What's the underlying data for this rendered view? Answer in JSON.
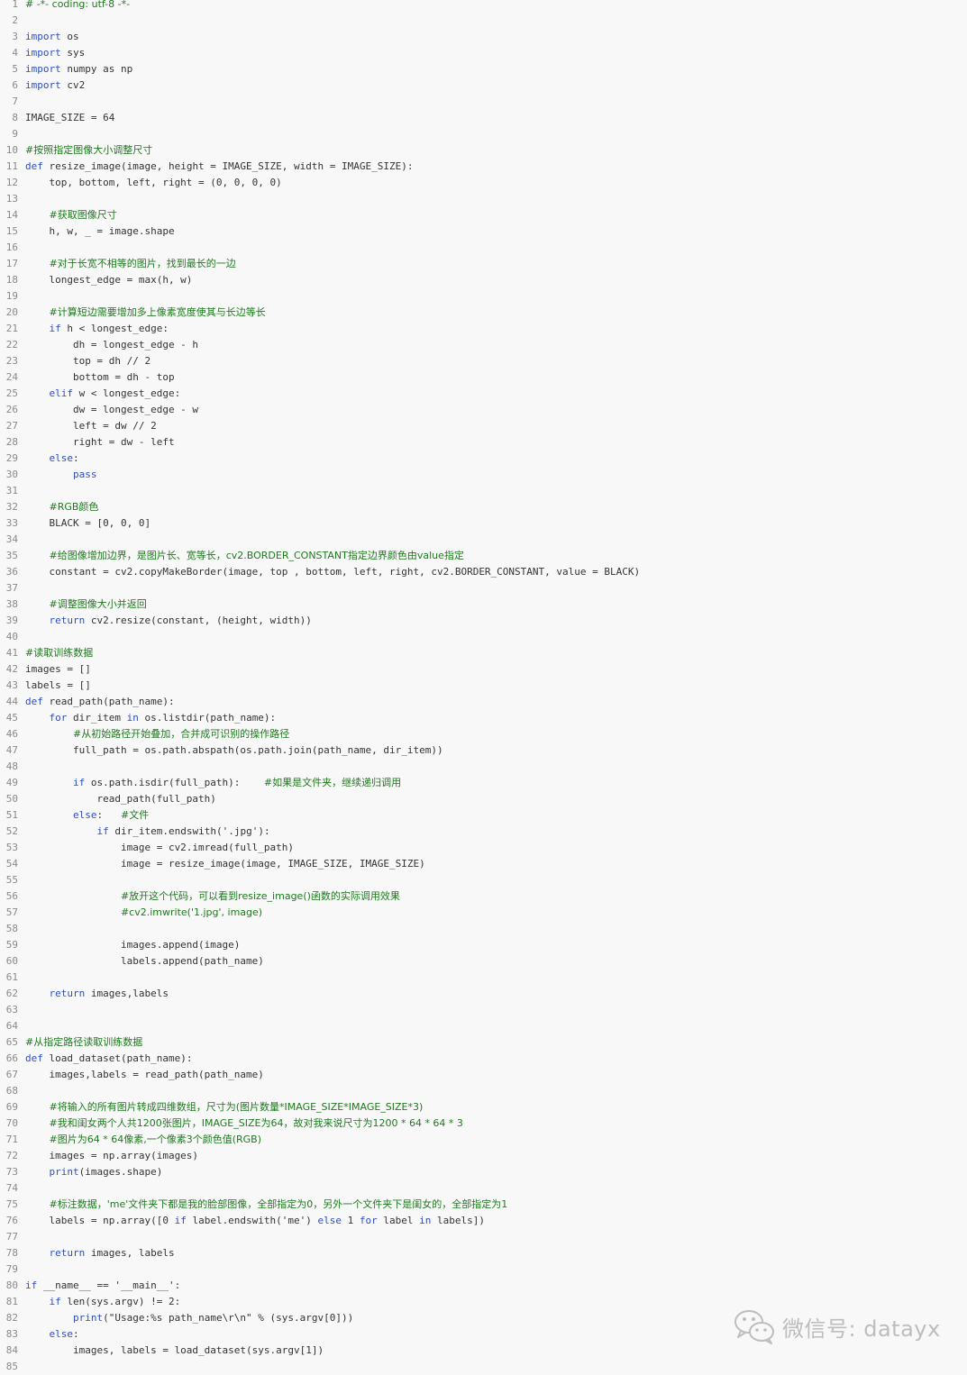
{
  "code_lines": [
    [
      [
        "cm",
        "# -*- coding: utf-8 -*-"
      ]
    ],
    [],
    [
      [
        "kw",
        "import"
      ],
      [
        "t",
        " os"
      ]
    ],
    [
      [
        "kw",
        "import"
      ],
      [
        "t",
        " sys"
      ]
    ],
    [
      [
        "kw",
        "import"
      ],
      [
        "t",
        " numpy as np"
      ]
    ],
    [
      [
        "kw",
        "import"
      ],
      [
        "t",
        " cv2"
      ]
    ],
    [],
    [
      [
        "t",
        "IMAGE_SIZE = 64"
      ]
    ],
    [],
    [
      [
        "cm",
        "#按照指定图像大小调整尺寸"
      ]
    ],
    [
      [
        "kw",
        "def"
      ],
      [
        "t",
        " resize_image(image, height = IMAGE_SIZE, width = IMAGE_SIZE):"
      ]
    ],
    [
      [
        "t",
        "    top, bottom, left, right = (0, 0, 0, 0)"
      ]
    ],
    [],
    [
      [
        "t",
        "    "
      ],
      [
        "cm",
        "#获取图像尺寸"
      ]
    ],
    [
      [
        "t",
        "    h, w, _ = image.shape"
      ]
    ],
    [],
    [
      [
        "t",
        "    "
      ],
      [
        "cm",
        "#对于长宽不相等的图片，找到最长的一边"
      ]
    ],
    [
      [
        "t",
        "    longest_edge = max(h, w)"
      ]
    ],
    [],
    [
      [
        "t",
        "    "
      ],
      [
        "cm",
        "#计算短边需要增加多上像素宽度使其与长边等长"
      ]
    ],
    [
      [
        "t",
        "    "
      ],
      [
        "kw",
        "if"
      ],
      [
        "t",
        " h < longest_edge:"
      ]
    ],
    [
      [
        "t",
        "        dh = longest_edge - h"
      ]
    ],
    [
      [
        "t",
        "        top = dh // 2"
      ]
    ],
    [
      [
        "t",
        "        bottom = dh - top"
      ]
    ],
    [
      [
        "t",
        "    "
      ],
      [
        "kw",
        "elif"
      ],
      [
        "t",
        " w < longest_edge:"
      ]
    ],
    [
      [
        "t",
        "        dw = longest_edge - w"
      ]
    ],
    [
      [
        "t",
        "        left = dw // 2"
      ]
    ],
    [
      [
        "t",
        "        right = dw - left"
      ]
    ],
    [
      [
        "t",
        "    "
      ],
      [
        "kw",
        "else"
      ],
      [
        "t",
        ":"
      ]
    ],
    [
      [
        "t",
        "        "
      ],
      [
        "kw",
        "pass"
      ]
    ],
    [],
    [
      [
        "t",
        "    "
      ],
      [
        "cm",
        "#RGB颜色"
      ]
    ],
    [
      [
        "t",
        "    BLACK = [0, 0, 0]"
      ]
    ],
    [],
    [
      [
        "t",
        "    "
      ],
      [
        "cm",
        "#给图像增加边界，是图片长、宽等长，cv2.BORDER_CONSTANT指定边界颜色由value指定"
      ]
    ],
    [
      [
        "t",
        "    constant = cv2.copyMakeBorder(image, top , bottom, left, right, cv2.BORDER_CONSTANT, value = BLACK)"
      ]
    ],
    [],
    [
      [
        "t",
        "    "
      ],
      [
        "cm",
        "#调整图像大小并返回"
      ]
    ],
    [
      [
        "t",
        "    "
      ],
      [
        "kw",
        "return"
      ],
      [
        "t",
        " cv2.resize(constant, (height, width))"
      ]
    ],
    [],
    [
      [
        "cm",
        "#读取训练数据"
      ]
    ],
    [
      [
        "t",
        "images = []"
      ]
    ],
    [
      [
        "t",
        "labels = []"
      ]
    ],
    [
      [
        "kw",
        "def"
      ],
      [
        "t",
        " read_path(path_name):"
      ]
    ],
    [
      [
        "t",
        "    "
      ],
      [
        "kw",
        "for"
      ],
      [
        "t",
        " dir_item "
      ],
      [
        "kw",
        "in"
      ],
      [
        "t",
        " os.listdir(path_name):"
      ]
    ],
    [
      [
        "t",
        "        "
      ],
      [
        "cm",
        "#从初始路径开始叠加，合并成可识别的操作路径"
      ]
    ],
    [
      [
        "t",
        "        full_path = os.path.abspath(os.path.join(path_name, dir_item))"
      ]
    ],
    [],
    [
      [
        "t",
        "        "
      ],
      [
        "kw",
        "if"
      ],
      [
        "t",
        " os.path.isdir(full_path):    "
      ],
      [
        "cm",
        "#如果是文件夹，继续递归调用"
      ]
    ],
    [
      [
        "t",
        "            read_path(full_path)"
      ]
    ],
    [
      [
        "t",
        "        "
      ],
      [
        "kw",
        "else"
      ],
      [
        "t",
        ":   "
      ],
      [
        "cm",
        "#文件"
      ]
    ],
    [
      [
        "t",
        "            "
      ],
      [
        "kw",
        "if"
      ],
      [
        "t",
        " dir_item.endswith("
      ],
      [
        "str",
        "'.jpg'"
      ],
      [
        "t",
        "):"
      ]
    ],
    [
      [
        "t",
        "                image = cv2.imread(full_path)"
      ]
    ],
    [
      [
        "t",
        "                image = resize_image(image, IMAGE_SIZE, IMAGE_SIZE)"
      ]
    ],
    [],
    [
      [
        "t",
        "                "
      ],
      [
        "cm",
        "#放开这个代码，可以看到resize_image()函数的实际调用效果"
      ]
    ],
    [
      [
        "t",
        "                "
      ],
      [
        "cm",
        "#cv2.imwrite('1.jpg', image)"
      ]
    ],
    [],
    [
      [
        "t",
        "                images.append(image)"
      ]
    ],
    [
      [
        "t",
        "                labels.append(path_name)"
      ]
    ],
    [],
    [
      [
        "t",
        "    "
      ],
      [
        "kw",
        "return"
      ],
      [
        "t",
        " images,labels"
      ]
    ],
    [],
    [],
    [
      [
        "cm",
        "#从指定路径读取训练数据"
      ]
    ],
    [
      [
        "kw",
        "def"
      ],
      [
        "t",
        " load_dataset(path_name):"
      ]
    ],
    [
      [
        "t",
        "    images,labels = read_path(path_name)"
      ]
    ],
    [],
    [
      [
        "t",
        "    "
      ],
      [
        "cm",
        "#将输入的所有图片转成四维数组，尺寸为(图片数量*IMAGE_SIZE*IMAGE_SIZE*3)"
      ]
    ],
    [
      [
        "t",
        "    "
      ],
      [
        "cm",
        "#我和闺女两个人共1200张图片，IMAGE_SIZE为64，故对我来说尺寸为1200 * 64 * 64 * 3"
      ]
    ],
    [
      [
        "t",
        "    "
      ],
      [
        "cm",
        "#图片为64 * 64像素,一个像素3个颜色值(RGB)"
      ]
    ],
    [
      [
        "t",
        "    images = np.array(images)"
      ]
    ],
    [
      [
        "t",
        "    "
      ],
      [
        "kw",
        "print"
      ],
      [
        "t",
        "(images.shape)"
      ]
    ],
    [],
    [
      [
        "t",
        "    "
      ],
      [
        "cm",
        "#标注数据，'me'文件夹下都是我的脸部图像，全部指定为0，另外一个文件夹下是闺女的，全部指定为1"
      ]
    ],
    [
      [
        "t",
        "    labels = np.array([0 "
      ],
      [
        "kw",
        "if"
      ],
      [
        "t",
        " label.endswith("
      ],
      [
        "str",
        "'me'"
      ],
      [
        "t",
        ") "
      ],
      [
        "kw",
        "else"
      ],
      [
        "t",
        " 1 "
      ],
      [
        "kw",
        "for"
      ],
      [
        "t",
        " label "
      ],
      [
        "kw",
        "in"
      ],
      [
        "t",
        " labels])"
      ]
    ],
    [],
    [
      [
        "t",
        "    "
      ],
      [
        "kw",
        "return"
      ],
      [
        "t",
        " images, labels"
      ]
    ],
    [],
    [
      [
        "kw",
        "if"
      ],
      [
        "t",
        " __name__ == "
      ],
      [
        "str",
        "'__main__'"
      ],
      [
        "t",
        ":"
      ]
    ],
    [
      [
        "t",
        "    "
      ],
      [
        "kw",
        "if"
      ],
      [
        "t",
        " len(sys.argv) != 2:"
      ]
    ],
    [
      [
        "t",
        "        "
      ],
      [
        "kw",
        "print"
      ],
      [
        "t",
        "("
      ],
      [
        "str",
        "\"Usage:%s path_name\\r\\n\""
      ],
      [
        "t",
        " % (sys.argv[0]))"
      ]
    ],
    [
      [
        "t",
        "    "
      ],
      [
        "kw",
        "else"
      ],
      [
        "t",
        ":"
      ]
    ],
    [
      [
        "t",
        "        images, labels = load_dataset(sys.argv[1])"
      ]
    ],
    []
  ],
  "watermark": {
    "icon": "wechat-icon",
    "text": "微信号: datayx",
    "color": "#bdbdbd"
  },
  "colors": {
    "background": "#f8f8f8",
    "text": "#333333",
    "line_number": "#8a8a8a",
    "keyword": "#2f4fbf",
    "comment": "#1d7a1d"
  }
}
